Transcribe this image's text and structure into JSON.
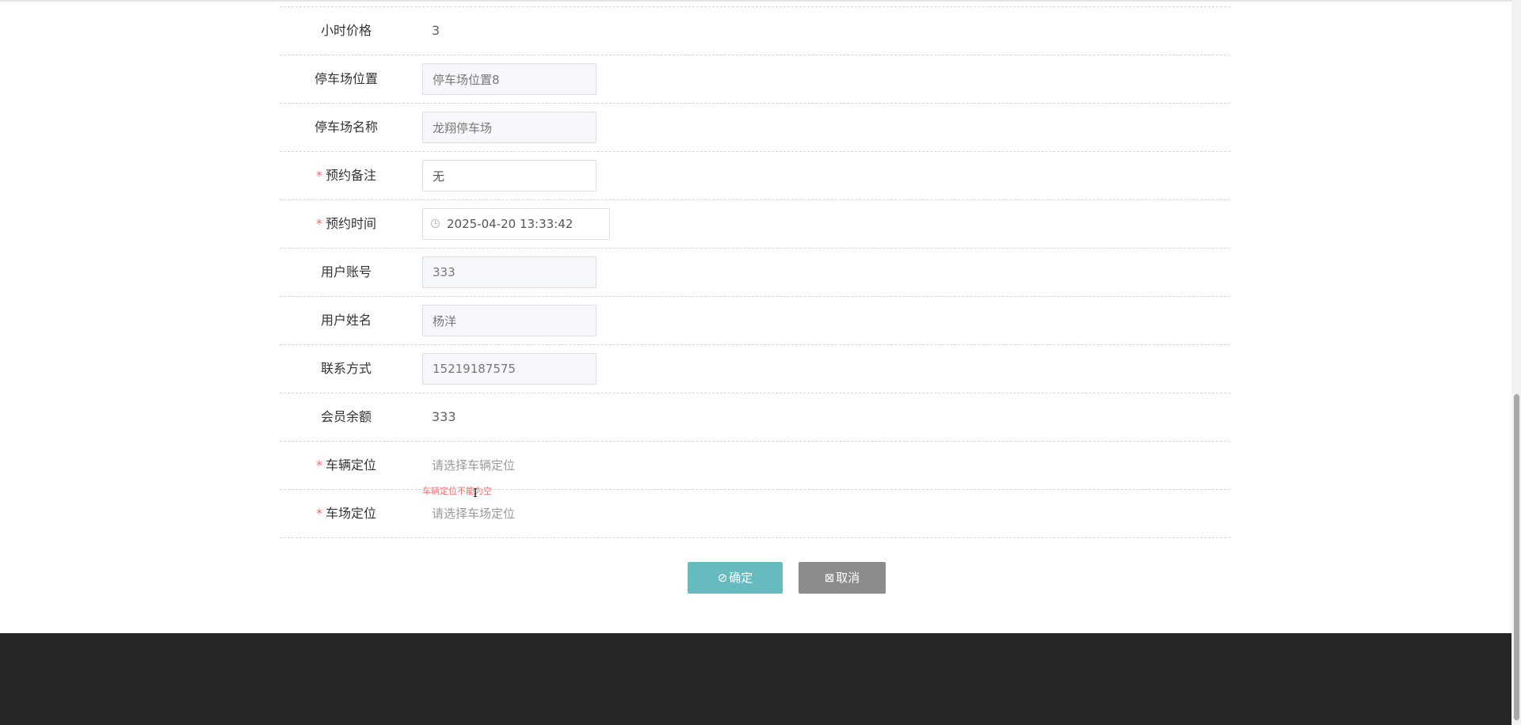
{
  "form": {
    "rows": [
      {
        "label": "小时价格",
        "required": false,
        "value": "3"
      },
      {
        "label": "停车场位置",
        "required": false,
        "value": "停车场位置8"
      },
      {
        "label": "停车场名称",
        "required": false,
        "value": "龙翔停车场"
      },
      {
        "label": "预约备注",
        "required": true,
        "value": "无"
      },
      {
        "label": "预约时间",
        "required": true,
        "value": "2025-04-20 13:33:42"
      },
      {
        "label": "用户账号",
        "required": false,
        "value": "333"
      },
      {
        "label": "用户姓名",
        "required": false,
        "value": "杨洋"
      },
      {
        "label": "联系方式",
        "required": false,
        "value": "15219187575"
      },
      {
        "label": "会员余额",
        "required": false,
        "value": "333"
      },
      {
        "label": "车辆定位",
        "required": true,
        "placeholder": "请选择车辆定位",
        "error": "车辆定位不能为空"
      },
      {
        "label": "车场定位",
        "required": true,
        "placeholder": "请选择车场定位"
      }
    ],
    "required_mark": "*"
  },
  "buttons": {
    "confirm_icon": "⊘",
    "confirm_label": "确定",
    "cancel_icon": "⊠",
    "cancel_label": "取消"
  },
  "colors": {
    "confirm": "#66bbbe",
    "cancel": "#8c8c8c",
    "footer": "#262626",
    "error": "#f56c6c"
  },
  "icons": {
    "date_field": "clock-icon",
    "confirm": "check-circle-icon",
    "cancel": "close-square-icon"
  }
}
